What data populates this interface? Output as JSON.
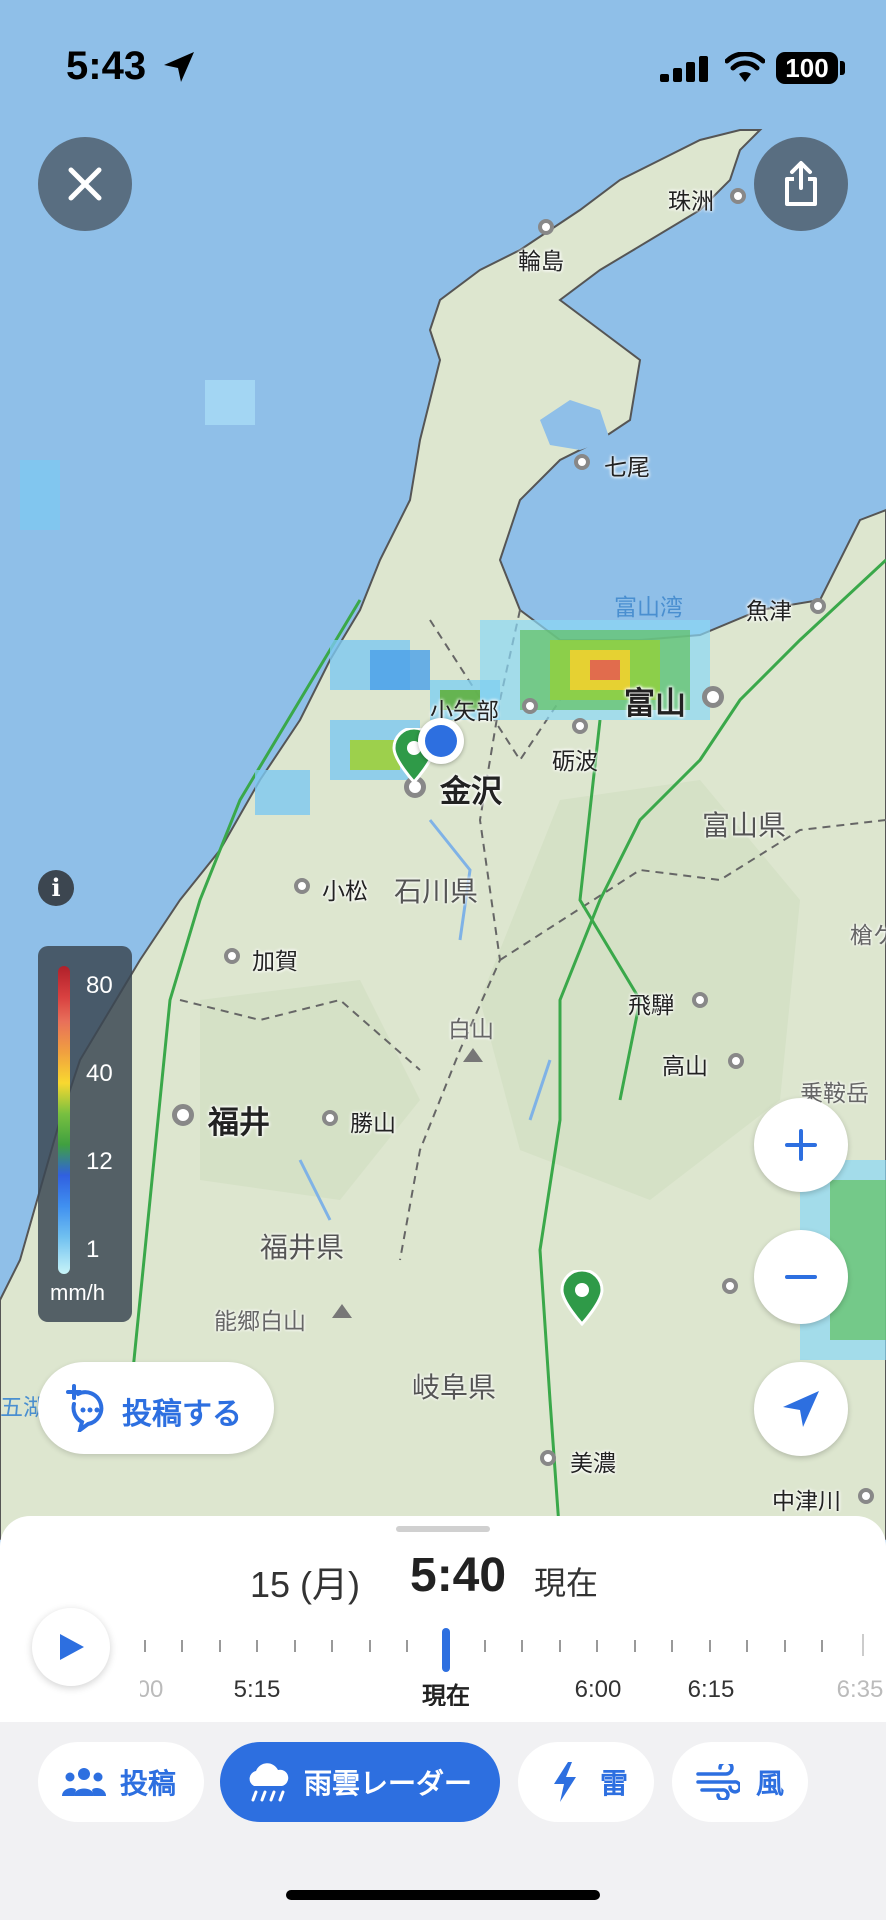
{
  "status_bar": {
    "time": "5:43",
    "battery": "100"
  },
  "map_labels": {
    "cities": {
      "suzu": "珠洲",
      "wajima": "輪島",
      "nanao": "七尾",
      "uozu": "魚津",
      "toyama": "富山",
      "oyabe": "小矢部",
      "tonami": "砺波",
      "kanazawa": "金沢",
      "komatsu": "小松",
      "kaga": "加賀",
      "fukui": "福井",
      "katsuyama": "勝山",
      "hida": "飛騨",
      "takayama": "高山",
      "mino": "美濃",
      "nakatsugawa": "中津川"
    },
    "prefectures": {
      "toyama": "富山県",
      "ishikawa": "石川県",
      "fukui": "福井県",
      "gifu": "岐阜県"
    },
    "mountains": {
      "hakusan": "白山",
      "nogohakusan": "能郷白山",
      "norikura": "乗鞍岳",
      "yari": "槍ケ"
    },
    "sea": {
      "toyama_bay": "富山湾",
      "gokako": "五湖"
    }
  },
  "legend": {
    "values": [
      "80",
      "40",
      "12",
      "1"
    ],
    "unit": "mm/h"
  },
  "info_icon": "i",
  "post_button": {
    "label": "投稿する"
  },
  "timeline": {
    "date": "15 (月)",
    "time": "5:40",
    "now_label": "現在",
    "labels": [
      "00",
      "5:15",
      "現在",
      "6:00",
      "6:15",
      "6:35"
    ]
  },
  "tabs": [
    {
      "label": "投稿",
      "icon": "people-icon"
    },
    {
      "label": "雨雲レーダー",
      "icon": "rain-cloud-icon",
      "active": true
    },
    {
      "label": "雷",
      "icon": "lightning-icon"
    },
    {
      "label": "風",
      "icon": "wind-icon"
    }
  ],
  "colors": {
    "accent": "#2d6fe0",
    "sea": "#8fbfe8",
    "land": "#dde6cf",
    "pin": "#2f9a48"
  }
}
